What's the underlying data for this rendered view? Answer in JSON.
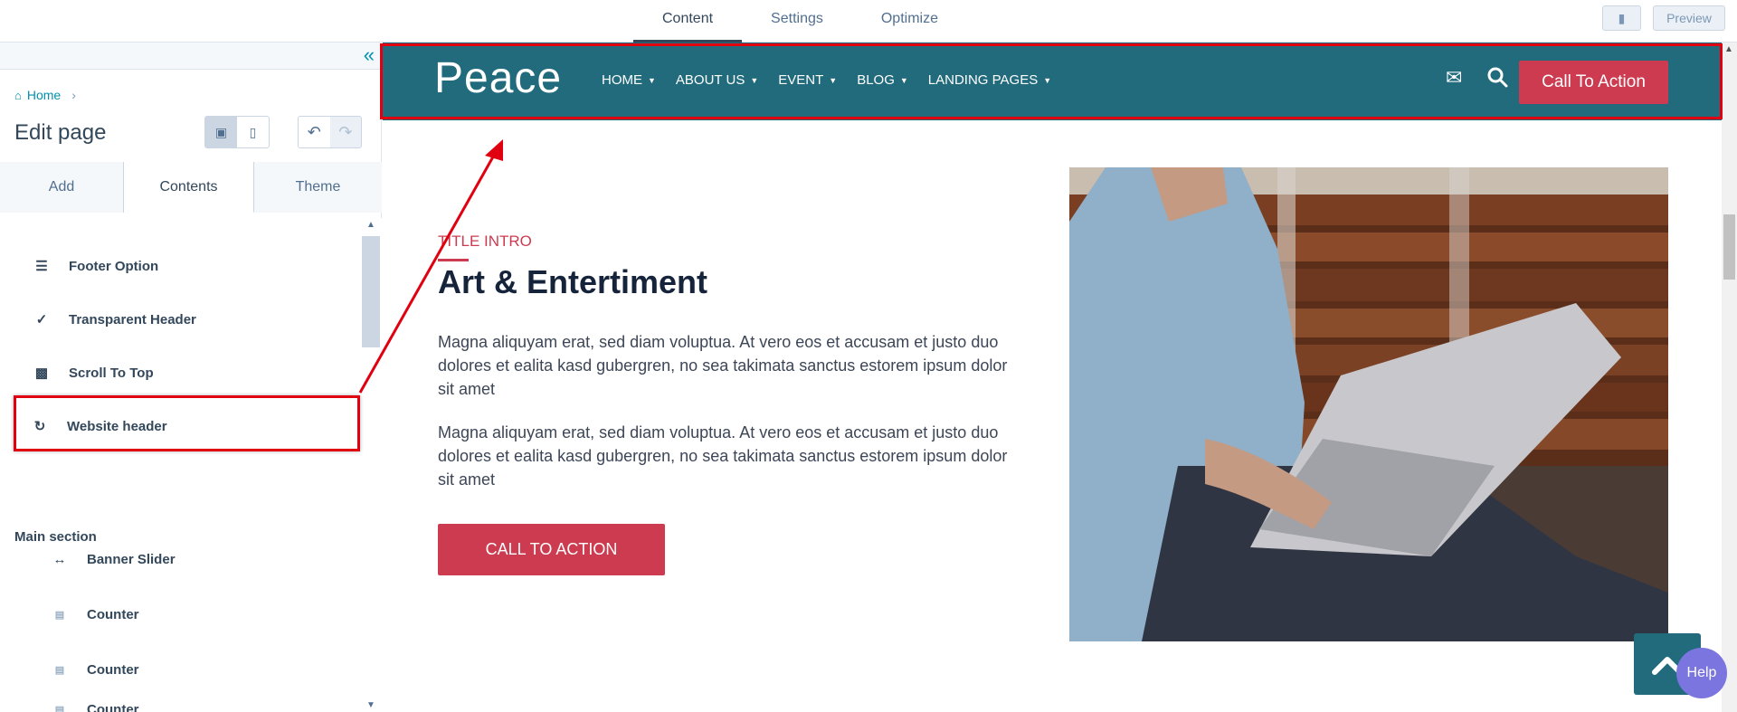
{
  "top_tabs": [
    {
      "label": "Content",
      "active": true
    },
    {
      "label": "Settings",
      "active": false
    },
    {
      "label": "Optimize",
      "active": false
    }
  ],
  "top_right": {
    "preview_label": "Preview",
    "chat_icon": "comment-icon"
  },
  "sidebar": {
    "collapse_icon": "double-chevron-left-icon",
    "breadcrumb": {
      "home": "Home"
    },
    "page_title": "Edit page",
    "view_icons": [
      "desktop-icon",
      "mobile-icon"
    ],
    "history_icons": [
      "undo-icon",
      "redo-icon"
    ],
    "tabs": [
      {
        "label": "Add",
        "active": false
      },
      {
        "label": "Contents",
        "active": true
      },
      {
        "label": "Theme",
        "active": false
      }
    ],
    "modules": [
      {
        "label": "Footer Option",
        "icon": "list-icon"
      },
      {
        "label": "Transparent Header",
        "icon": "check-icon"
      },
      {
        "label": "Scroll To Top",
        "icon": "cart-icon"
      },
      {
        "label": "Website header",
        "icon": "refresh-icon",
        "highlighted": true
      }
    ],
    "main_section_label": "Main section",
    "main_modules": [
      {
        "label": "Banner Slider",
        "icon": "arrows-horizontal-icon"
      },
      {
        "label": "Counter",
        "icon": "counter-icon"
      },
      {
        "label": "Counter",
        "icon": "counter-icon"
      },
      {
        "label": "Counter",
        "icon": "counter-icon"
      }
    ]
  },
  "site_header": {
    "logo": "Peace",
    "nav": [
      "HOME",
      "ABOUT US",
      "EVENT",
      "BLOG",
      "LANDING PAGES"
    ],
    "icons": [
      "mail-icon",
      "search-icon"
    ],
    "cta_label": "Call To Action",
    "accent_color": "#216b7d",
    "cta_color": "#cc3b50"
  },
  "content": {
    "title_intro": "TITLE INTRO",
    "heading": "Art & Entertiment",
    "paragraph1": "Magna aliquyam erat, sed diam voluptua. At vero eos et accusam et justo duo dolores et ealita kasd gubergren, no sea takimata sanctus estorem ipsum dolor sit amet",
    "paragraph2": "Magna aliquyam erat, sed diam voluptua. At vero eos et accusam et justo duo dolores et ealita kasd gubergren, no sea takimata sanctus estorem ipsum dolor sit amet",
    "cta_label": "CALL TO ACTION"
  },
  "floating": {
    "help_label": "Help",
    "to_top_icon": "chevron-up-icon"
  },
  "annotation": {
    "color": "#e1000f"
  }
}
